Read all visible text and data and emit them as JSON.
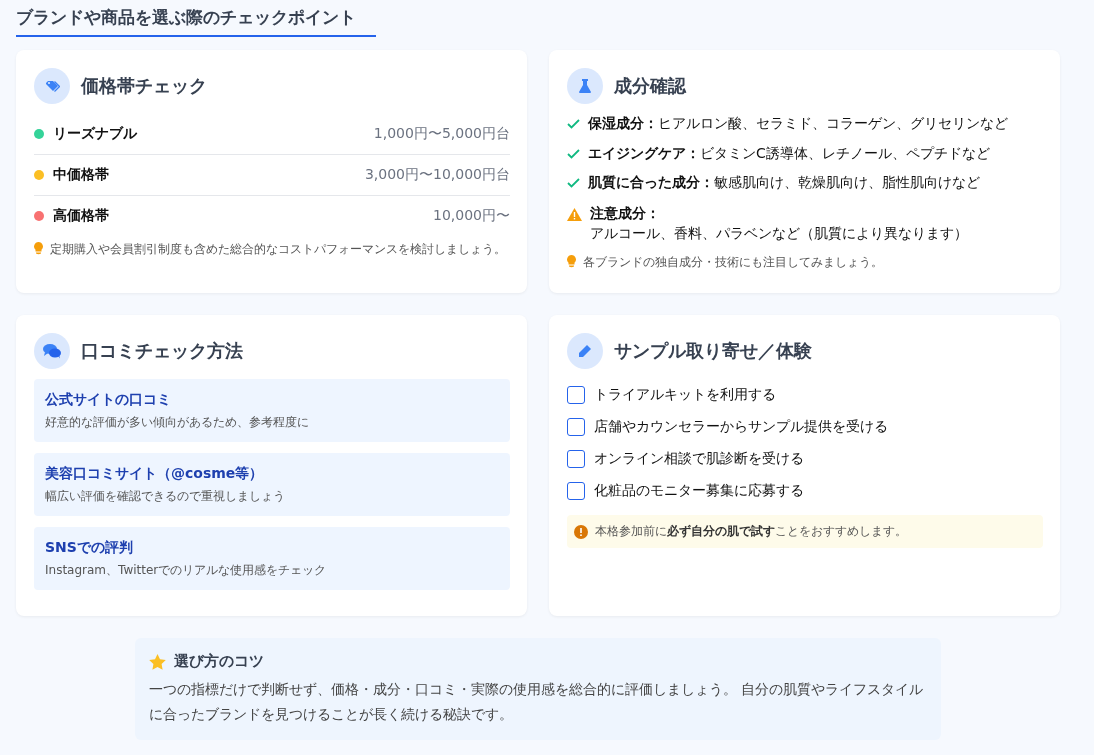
{
  "page_title": "ブランドや商品を選ぶ際のチェックポイント",
  "cards": [
    {
      "kind": "price",
      "title": "価格帯チェック",
      "rows": [
        {
          "label": "リーズナブル",
          "range": "1,000円〜5,000円台",
          "color": "#34d399"
        },
        {
          "label": "中価格帯",
          "range": "3,000円〜10,000円台",
          "color": "#fbbf24"
        },
        {
          "label": "高価格帯",
          "range": "10,000円〜",
          "color": "#f87171"
        }
      ],
      "note": "定期購入や会員割引制度も含めた総合的なコストパフォーマンスを検討しましょう。"
    },
    {
      "kind": "ingredients",
      "title": "成分確認",
      "items": [
        {
          "kind": "check",
          "label": "保湿成分：",
          "text": "ヒアルロン酸、セラミド、コラーゲン、グリセリンなど"
        },
        {
          "kind": "check",
          "label": "エイジングケア：",
          "text": "ビタミンC誘導体、レチノール、ペプチドなど"
        },
        {
          "kind": "check",
          "label": "肌質に合った成分：",
          "text": "敏感肌向け、乾燥肌向け、脂性肌向けなど"
        },
        {
          "kind": "warning",
          "label": "注意成分：",
          "text": "アルコール、香料、パラベンなど（肌質により異なります）"
        }
      ],
      "note": "各ブランドの独自成分・技術にも注目してみましょう。"
    },
    {
      "kind": "reviews",
      "title": "口コミチェック方法",
      "sources": [
        {
          "title": "公式サイトの口コミ",
          "description": "好意的な評価が多い傾向があるため、参考程度に"
        },
        {
          "title": "美容口コミサイト（@cosme等）",
          "description": "幅広い評価を確認できるので重視しましょう"
        },
        {
          "title": "SNSでの評判",
          "description": "Instagram、Twitterでのリアルな使用感をチェック"
        }
      ]
    },
    {
      "kind": "samples",
      "title": "サンプル取り寄せ／体験",
      "options": [
        {
          "label": "トライアルキットを利用する",
          "checked": false
        },
        {
          "label": "店舗やカウンセラーからサンプル提供を受ける",
          "checked": false
        },
        {
          "label": "オンライン相談で肌診断を受ける",
          "checked": false
        },
        {
          "label": "化粧品のモニター募集に応募する",
          "checked": false
        }
      ],
      "notice": "本格参加前に**必ず自分の肌で試す**ことをおすすめします。"
    }
  ],
  "tip": {
    "title": "選び方のコツ",
    "text": "一つの指標だけで判断せず、価格・成分・口コミ・実際の使用感を総合的に評価しましょう。 自分の肌質やライフスタイルに合ったブランドを見つけることが長く続ける秘訣です。"
  }
}
